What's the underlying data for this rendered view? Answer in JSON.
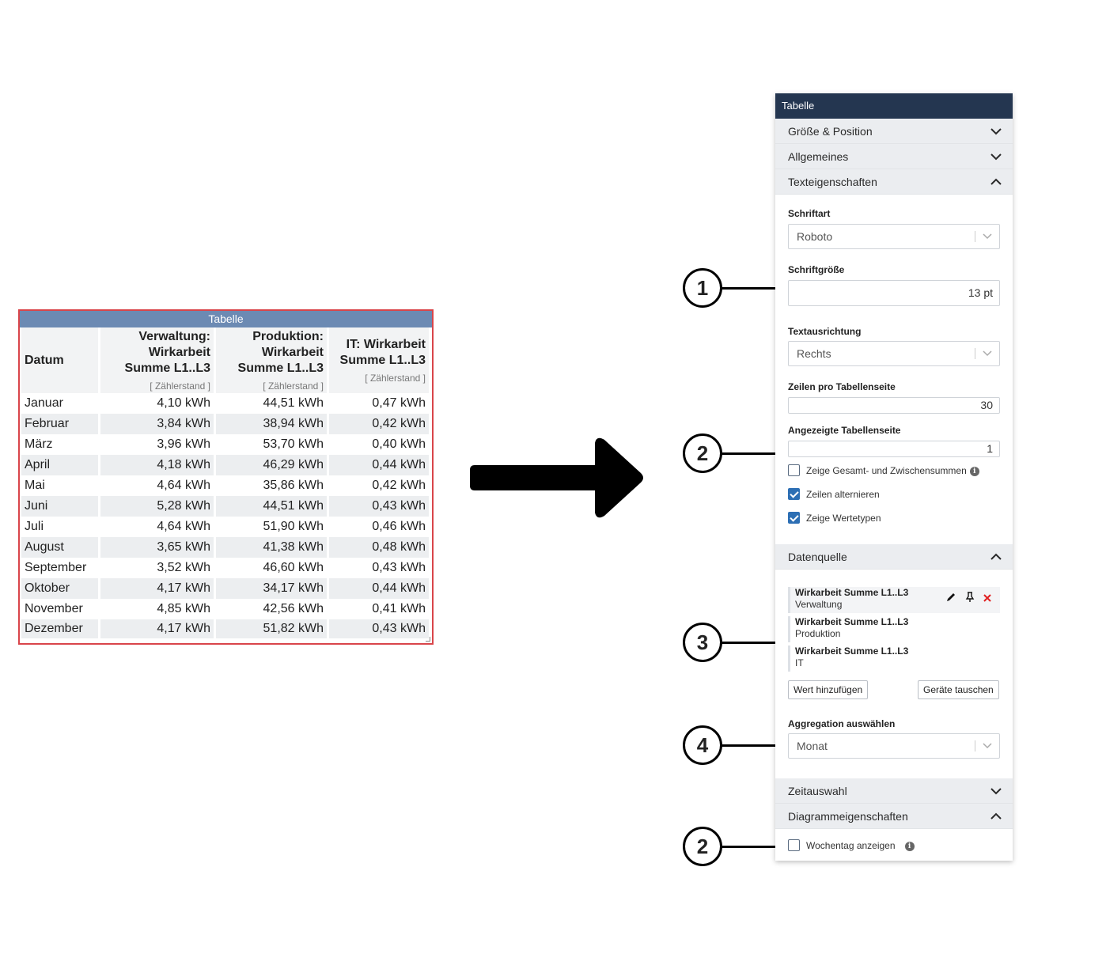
{
  "table_widget": {
    "title": "Tabelle",
    "headers": [
      {
        "label": "Datum",
        "unit": ""
      },
      {
        "label": "Verwaltung: Wirkarbeit Summe L1..L3",
        "line1": "Verwaltung:",
        "line2": "Wirkarbeit",
        "line3": "Summe L1..L3",
        "unit": "[ Zählerstand ]"
      },
      {
        "label": "Produktion: Wirkarbeit Summe L1..L3",
        "line1": "Produktion:",
        "line2": "Wirkarbeit",
        "line3": "Summe L1..L3",
        "unit": "[ Zählerstand ]"
      },
      {
        "label": "IT: Wirkarbeit Summe L1..L3",
        "line1": "IT: Wirkarbeit",
        "line2": "Summe L1..L3",
        "unit": "[ Zählerstand ]"
      }
    ],
    "rows": [
      [
        "Januar",
        "4,10 kWh",
        "44,51 kWh",
        "0,47 kWh"
      ],
      [
        "Februar",
        "3,84 kWh",
        "38,94 kWh",
        "0,42 kWh"
      ],
      [
        "März",
        "3,96 kWh",
        "53,70 kWh",
        "0,40 kWh"
      ],
      [
        "April",
        "4,18 kWh",
        "46,29 kWh",
        "0,44 kWh"
      ],
      [
        "Mai",
        "4,64 kWh",
        "35,86 kWh",
        "0,42 kWh"
      ],
      [
        "Juni",
        "5,28 kWh",
        "44,51 kWh",
        "0,43 kWh"
      ],
      [
        "Juli",
        "4,64 kWh",
        "51,90 kWh",
        "0,46 kWh"
      ],
      [
        "August",
        "3,65 kWh",
        "41,38 kWh",
        "0,48 kWh"
      ],
      [
        "September",
        "3,52 kWh",
        "46,60 kWh",
        "0,43 kWh"
      ],
      [
        "Oktober",
        "4,17 kWh",
        "34,17 kWh",
        "0,44 kWh"
      ],
      [
        "November",
        "4,85 kWh",
        "42,56 kWh",
        "0,41 kWh"
      ],
      [
        "Dezember",
        "4,17 kWh",
        "51,82 kWh",
        "0,43 kWh"
      ]
    ]
  },
  "callouts": [
    "1",
    "2",
    "3",
    "4",
    "2"
  ],
  "panel": {
    "title": "Tabelle",
    "sections": {
      "groesse": "Größe & Position",
      "allgemeines": "Allgemeines",
      "texteigenschaften": "Texteigenschaften",
      "datenquelle": "Datenquelle",
      "zeitauswahl": "Zeitauswahl",
      "diagramm": "Diagrammeigenschaften"
    },
    "schriftart": {
      "label": "Schriftart",
      "value": "Roboto"
    },
    "schriftgroesse": {
      "label": "Schriftgröße",
      "value": "13 pt"
    },
    "textausrichtung": {
      "label": "Textausrichtung",
      "value": "Rechts"
    },
    "zeilen_pro_seite": {
      "label": "Zeilen pro Tabellenseite",
      "value": "30"
    },
    "angezeigte_seite": {
      "label": "Angezeigte Tabellenseite",
      "value": "1"
    },
    "checkboxes": {
      "gesamtsummen": {
        "label": "Zeige Gesamt- und Zwischensummen",
        "checked": false
      },
      "zeilen_alternieren": {
        "label": "Zeilen alternieren",
        "checked": true
      },
      "wertetypen": {
        "label": "Zeige Wertetypen",
        "checked": true
      },
      "wochentag": {
        "label": "Wochentag anzeigen",
        "checked": false
      }
    },
    "datasources": [
      {
        "title": "Wirkarbeit Summe L1..L3",
        "device": "Verwaltung"
      },
      {
        "title": "Wirkarbeit Summe L1..L3",
        "device": "Produktion"
      },
      {
        "title": "Wirkarbeit Summe L1..L3",
        "device": "IT"
      }
    ],
    "buttons": {
      "add_value": "Wert hinzufügen",
      "swap_devices": "Geräte tauschen"
    },
    "aggregation": {
      "label": "Aggregation auswählen",
      "value": "Monat"
    }
  }
}
